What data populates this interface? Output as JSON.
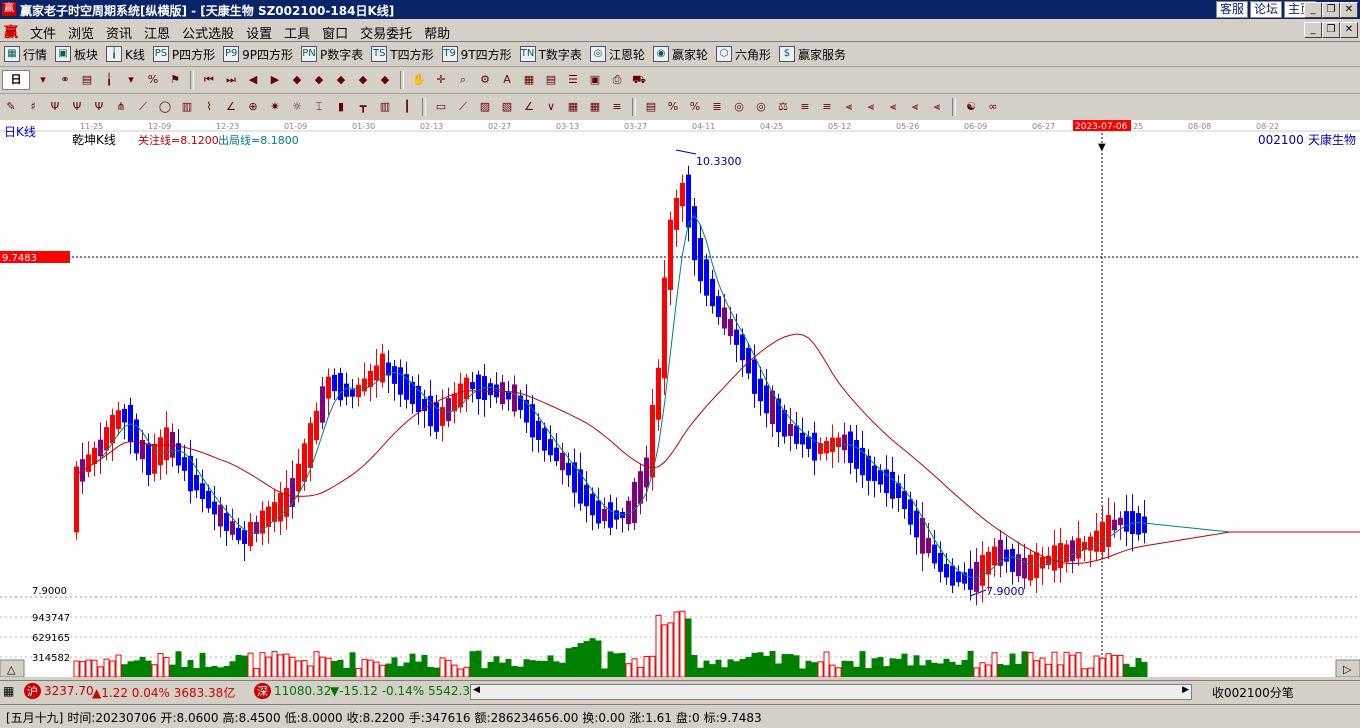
{
  "titlebar": {
    "title": "赢家老子时空周期系统[纵横版] - [天康生物   SZ002100-184日K线]",
    "links": [
      "客服",
      "论坛",
      "主页"
    ]
  },
  "menubar": {
    "logo": "赢",
    "items": [
      "文件",
      "浏览",
      "资讯",
      "江恩",
      "公式选股",
      "设置",
      "工具",
      "窗口",
      "交易委托",
      "帮助"
    ]
  },
  "toolbar1": {
    "items": [
      {
        "icon": "grid-icon",
        "glyph": "▦",
        "label": "行情"
      },
      {
        "icon": "blocks-icon",
        "glyph": "▣",
        "label": "板块"
      },
      {
        "icon": "candles-icon",
        "glyph": "╽",
        "label": "K线"
      },
      {
        "icon": "ps-icon",
        "glyph": "PS",
        "label": "P四方形"
      },
      {
        "icon": "p9-icon",
        "glyph": "P9",
        "label": "9P四方形"
      },
      {
        "icon": "pn-icon",
        "glyph": "PN",
        "label": "P数字表"
      },
      {
        "icon": "ts-icon",
        "glyph": "TS",
        "label": "T四方形"
      },
      {
        "icon": "t9-icon",
        "glyph": "T9",
        "label": "9T四方形"
      },
      {
        "icon": "tn-icon",
        "glyph": "TN",
        "label": "T数字表"
      },
      {
        "icon": "wheel-icon",
        "glyph": "◎",
        "label": "江恩轮"
      },
      {
        "icon": "winner-wheel-icon",
        "glyph": "◉",
        "label": "赢家轮"
      },
      {
        "icon": "hexagon-icon",
        "glyph": "⬡",
        "label": "六角形"
      },
      {
        "icon": "dollar-icon",
        "glyph": "$",
        "label": "赢家服务"
      }
    ]
  },
  "toolbar2": {
    "period_label": "日"
  },
  "chart": {
    "left_label": "日K线",
    "indicator_name": "乾坤K线",
    "attention_line": "关注线=8.1200",
    "exit_line": "出局线=8.1800",
    "stock_code": "002100",
    "stock_name": "天康生物",
    "cursor_price": "9.7483",
    "cursor_date": "2023-07-06",
    "high_label": "10.3300",
    "low_label": "7.9000",
    "axis_low": "7.9000",
    "vol_ticks": [
      "943747",
      "629165",
      "314582"
    ],
    "dates": [
      "11-25",
      "12-09",
      "12-23",
      "01-09",
      "01-30",
      "02-13",
      "02-27",
      "03-13",
      "03-27",
      "04-11",
      "04-25",
      "05-12",
      "05-26",
      "06-09",
      "06-27",
      "07-25",
      "08-08",
      "08-22"
    ],
    "colors": {
      "up": "#ff0000",
      "down": "#0000ff",
      "mixed": "#800080",
      "ma_short": "#008080",
      "ma_long": "#c00000"
    }
  },
  "statusbar": {
    "sh_badge": "沪",
    "sh_index": "3237.70",
    "sh_change": "▲1.22 0.04% 3683.38亿",
    "sz_badge": "深",
    "sz_index": "11080.32",
    "sz_change": "▼-15.12 -0.14% 5542.3",
    "right_text": "收002100分笔"
  },
  "infobar": {
    "lunar": "[五月十九]",
    "time": "时间:20230706",
    "open": "开:8.0600",
    "high": "高:8.4500",
    "low": "低:8.0000",
    "close": "收:8.2200",
    "volume": "手:347616",
    "amount": "额:286234656.00",
    "turnover": "换:0.00",
    "change": "涨:1.61",
    "pan": "盘:0",
    "mark": "标:9.7483"
  },
  "chart_data": {
    "type": "candlestick",
    "title": "乾坤K线",
    "y_range": [
      7.9,
      10.33
    ],
    "annotations": {
      "high": 10.33,
      "low": 7.9,
      "cursor_price": 9.7483,
      "cursor_date": "2023-07-06"
    },
    "last_bar": {
      "date": "2023-07-06",
      "open": 8.06,
      "high": 8.45,
      "low": 8.0,
      "close": 8.22,
      "volume": 347616
    }
  }
}
